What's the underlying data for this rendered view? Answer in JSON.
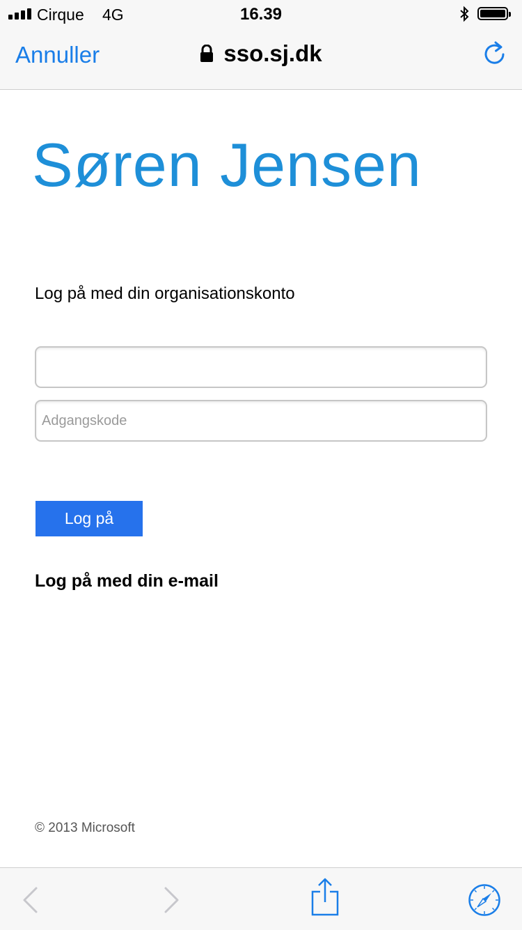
{
  "status": {
    "carrier": "Cirque",
    "network": "4G",
    "time": "16.39",
    "signal_bars": 4,
    "battery_level": 1.0
  },
  "nav": {
    "cancel_label": "Annuller",
    "url": "sso.sj.dk",
    "reload_icon": "reload-icon",
    "accent_color": "#1a7ee8"
  },
  "page": {
    "logo_text": "Søren Jensen",
    "logo_color": "#1e8fd8",
    "prompt": "Log på med din organisationskonto",
    "username": {
      "value": "",
      "placeholder": ""
    },
    "password": {
      "value": "",
      "placeholder": "Adgangskode"
    },
    "submit_label": "Log på",
    "submit_color": "#2672ec",
    "email_link": "Log på med din e-mail",
    "copyright": "© 2013 Microsoft"
  },
  "toolbar": {
    "back_icon": "chevron-left-icon",
    "forward_icon": "chevron-right-icon",
    "share_icon": "share-icon",
    "safari_icon": "compass-icon"
  }
}
